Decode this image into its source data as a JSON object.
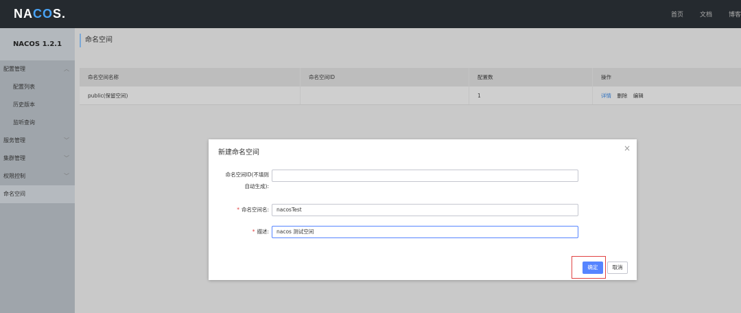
{
  "header": {
    "logo_pre": "NA",
    "logo_oo": "CO",
    "logo_post": "S.",
    "nav": [
      "首页",
      "文档",
      "博客"
    ]
  },
  "sidebar": {
    "version": "NACOS 1.2.1",
    "items": [
      {
        "label": "配置管理",
        "type": "group",
        "chevron": "up"
      },
      {
        "label": "配置列表",
        "type": "sub"
      },
      {
        "label": "历史版本",
        "type": "sub"
      },
      {
        "label": "监听查询",
        "type": "sub"
      },
      {
        "label": "服务管理",
        "type": "group",
        "chevron": "down"
      },
      {
        "label": "集群管理",
        "type": "group",
        "chevron": "down"
      },
      {
        "label": "权限控制",
        "type": "group",
        "chevron": "down"
      },
      {
        "label": "命名空间",
        "type": "group",
        "active": true
      }
    ]
  },
  "page": {
    "title": "命名空间"
  },
  "table": {
    "columns": [
      "命名空间名称",
      "命名空间ID",
      "配置数",
      "操作"
    ],
    "rows": [
      {
        "name": "public(保留空间)",
        "id": "",
        "count": "1",
        "ops": [
          "详情",
          "删除",
          "编辑"
        ]
      }
    ]
  },
  "dialog": {
    "title": "新建命名空间",
    "id_label_line1": "命名空间ID(不填则",
    "id_label_line2": "自动生成):",
    "id_value": "",
    "name_label": "命名空间名:",
    "name_value": "nacosTest",
    "desc_label": "描述:",
    "desc_value": "nacos 测试空间",
    "required_mark": "*",
    "ok_label": "确定",
    "cancel_label": "取消",
    "close_glyph": "×"
  },
  "colors": {
    "primary": "#5584ff",
    "topbar": "#252a2f",
    "required": "#e03c3c",
    "highlight": "#e04040"
  }
}
